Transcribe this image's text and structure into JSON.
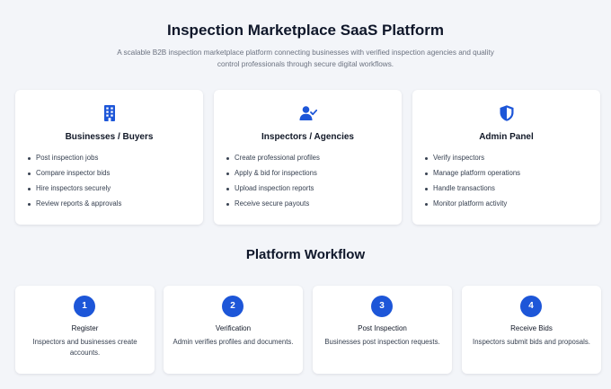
{
  "header": {
    "title": "Inspection Marketplace SaaS Platform",
    "subtitle": "A scalable B2B inspection marketplace platform connecting businesses with verified inspection agencies and quality control professionals through secure digital workflows."
  },
  "colors": {
    "accent": "#1d56d8",
    "background": "#f3f5f9",
    "card": "#ffffff"
  },
  "roles": [
    {
      "icon": "building-icon",
      "title": "Businesses / Buyers",
      "items": [
        "Post inspection jobs",
        "Compare inspector bids",
        "Hire inspectors securely",
        "Review reports & approvals"
      ]
    },
    {
      "icon": "user-check-icon",
      "title": "Inspectors / Agencies",
      "items": [
        "Create professional profiles",
        "Apply & bid for inspections",
        "Upload inspection reports",
        "Receive secure payouts"
      ]
    },
    {
      "icon": "shield-icon",
      "title": "Admin Panel",
      "items": [
        "Verify inspectors",
        "Manage platform operations",
        "Handle transactions",
        "Monitor platform activity"
      ]
    }
  ],
  "workflow": {
    "title": "Platform Workflow",
    "steps": [
      {
        "number": "1",
        "title": "Register",
        "description": "Inspectors and businesses create accounts."
      },
      {
        "number": "2",
        "title": "Verification",
        "description": "Admin verifies profiles and documents."
      },
      {
        "number": "3",
        "title": "Post Inspection",
        "description": "Businesses post inspection requests."
      },
      {
        "number": "4",
        "title": "Receive Bids",
        "description": "Inspectors submit bids and proposals."
      }
    ]
  }
}
